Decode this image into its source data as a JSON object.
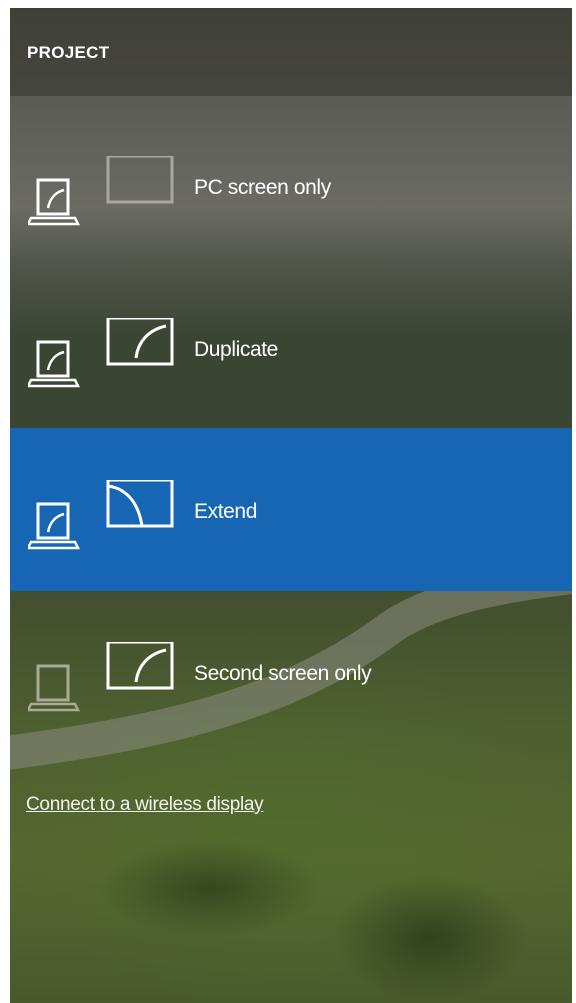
{
  "panel": {
    "title": "PROJECT"
  },
  "options": [
    {
      "label": "PC screen only",
      "icon": "pc-screen-only-icon",
      "selected": false
    },
    {
      "label": "Duplicate",
      "icon": "duplicate-icon",
      "selected": false
    },
    {
      "label": "Extend",
      "icon": "extend-icon",
      "selected": true
    },
    {
      "label": "Second screen only",
      "icon": "second-screen-only-icon",
      "selected": false
    }
  ],
  "wireless": {
    "link_label": "Connect to a wireless display"
  },
  "colors": {
    "selected_background": "#1666b4",
    "text": "#ffffff"
  }
}
